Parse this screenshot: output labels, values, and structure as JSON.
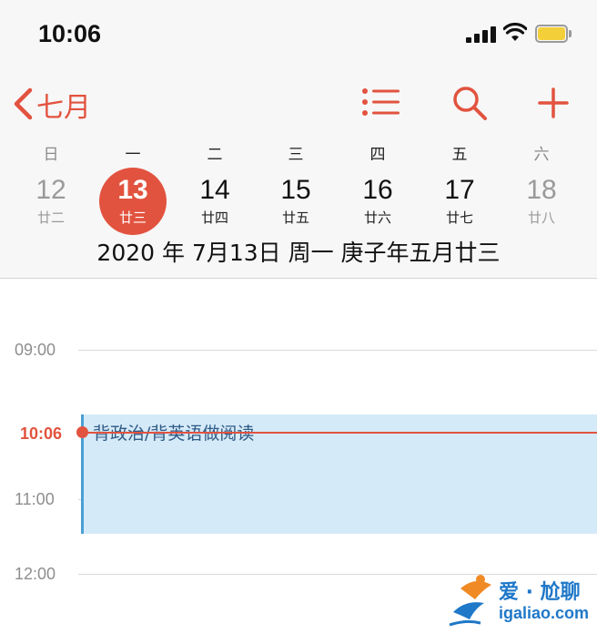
{
  "status_bar": {
    "time": "10:06"
  },
  "nav": {
    "back_label": "七月"
  },
  "week": {
    "weekdays": [
      "日",
      "一",
      "二",
      "三",
      "四",
      "五",
      "六"
    ],
    "days": [
      {
        "num": "12",
        "lunar": "廿二"
      },
      {
        "num": "13",
        "lunar": "廿三"
      },
      {
        "num": "14",
        "lunar": "廿四"
      },
      {
        "num": "15",
        "lunar": "廿五"
      },
      {
        "num": "16",
        "lunar": "廿六"
      },
      {
        "num": "17",
        "lunar": "廿七"
      },
      {
        "num": "18",
        "lunar": "廿八"
      }
    ]
  },
  "selected_date_text": "2020 年 7月13日 周一   庚子年五月廿三",
  "timeline": {
    "hours": [
      "09:00",
      "11:00",
      "12:00"
    ],
    "now": "10:06"
  },
  "event": {
    "title": "背政治/背英语做阅读"
  },
  "watermark": {
    "title": "爱 · 尬聊",
    "url": "igaliao.com"
  },
  "colors": {
    "accent": "#e2533f",
    "event_bg": "#d5eaf8",
    "event_bar": "#4a9fd6"
  }
}
